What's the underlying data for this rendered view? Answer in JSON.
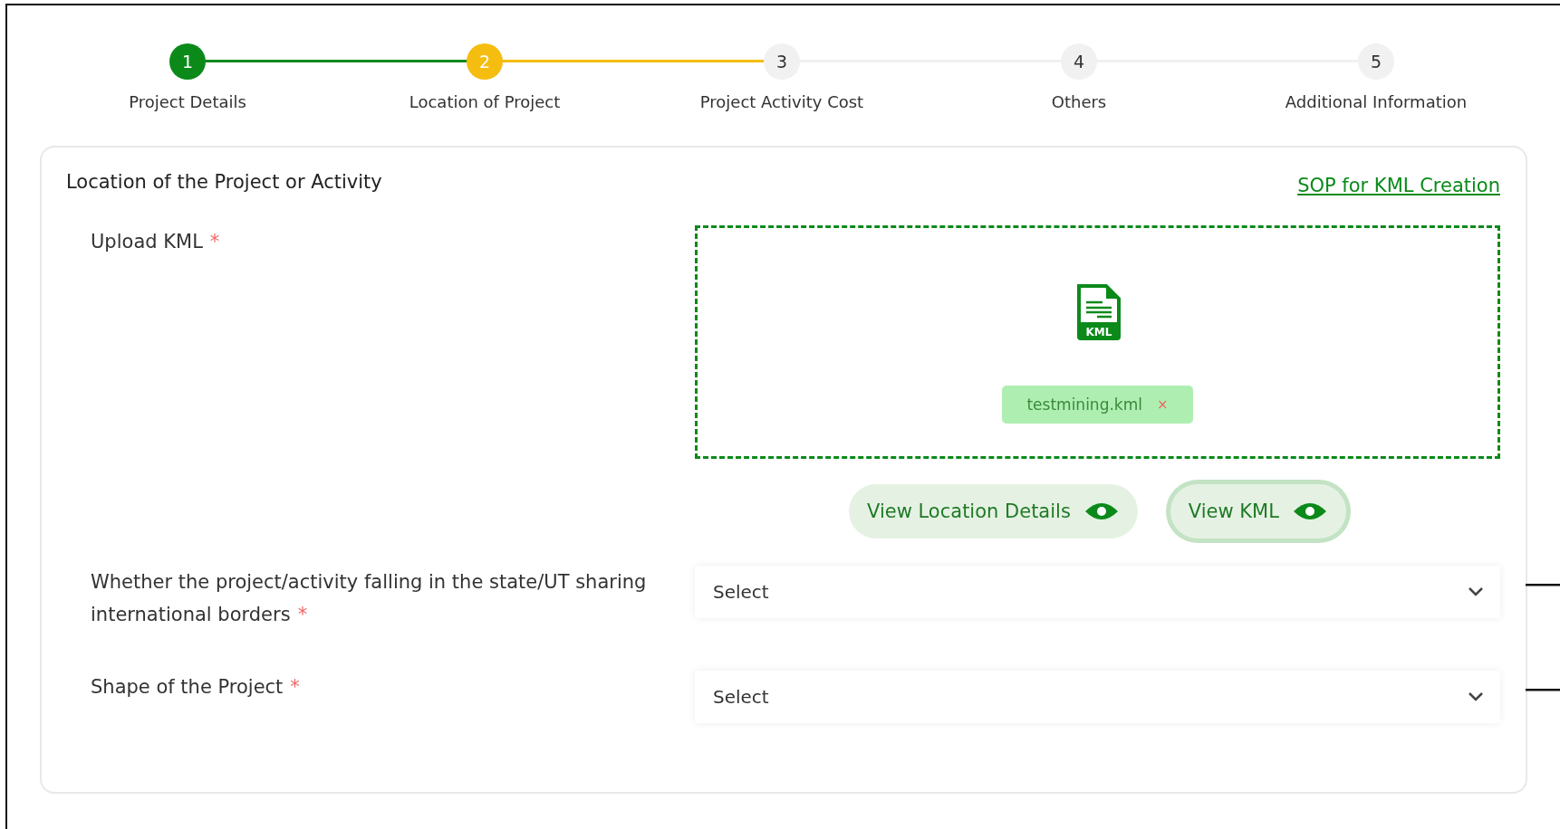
{
  "steps": [
    {
      "number": "1",
      "label": "Project Details",
      "completed": true,
      "selected": false
    },
    {
      "number": "2",
      "label": "Location of Project",
      "completed": false,
      "selected": true
    },
    {
      "number": "3",
      "label": "Project Activity Cost",
      "completed": false,
      "selected": false
    },
    {
      "number": "4",
      "label": "Others",
      "completed": false,
      "selected": false
    },
    {
      "number": "5",
      "label": "Additional Information",
      "completed": false,
      "selected": false
    }
  ],
  "section": {
    "title": "Location of the Project or Activity",
    "link": "SOP for KML Creation"
  },
  "upload": {
    "label": "Upload KML",
    "required_mark": "*",
    "file_badge": "KML",
    "file_name": "testmining.kml",
    "remove": "×"
  },
  "buttons": [
    {
      "label": "View Location Details",
      "focused": false
    },
    {
      "label": "View KML",
      "focused": true
    }
  ],
  "fields": [
    {
      "label": "Whether the project/activity falling in the state/UT sharing international borders",
      "required_mark": "*",
      "value": "Select"
    },
    {
      "label": "Shape of the Project",
      "required_mark": "*",
      "value": "Select"
    }
  ]
}
